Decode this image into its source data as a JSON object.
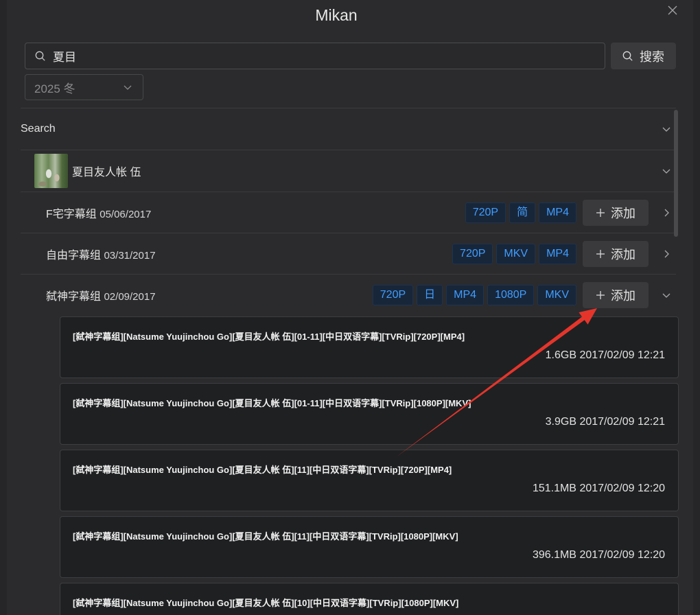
{
  "window": {
    "title": "Mikan"
  },
  "search": {
    "value": "夏目",
    "button_label": "搜索"
  },
  "season": {
    "selected": "2025 冬"
  },
  "results": {
    "section_label": "Search",
    "series": [
      {
        "title": "夏目友人帐 伍",
        "groups": [
          {
            "name": "F宅字幕组",
            "date": "05/06/2017",
            "tags": [
              "720P",
              "简",
              "MP4"
            ],
            "add_label": "添加",
            "chevron": "chevron-right-icon"
          },
          {
            "name": "自由字幕组",
            "date": "03/31/2017",
            "tags": [
              "720P",
              "MKV",
              "MP4"
            ],
            "add_label": "添加",
            "chevron": "chevron-right-icon"
          },
          {
            "name": "弑神字幕组",
            "date": "02/09/2017",
            "tags": [
              "720P",
              "日",
              "MP4",
              "1080P",
              "MKV"
            ],
            "add_label": "添加",
            "chevron": "chevron-down-icon",
            "files": [
              {
                "title": "[弑神字幕组][Natsume Yuujinchou Go][夏目友人帐 伍][01-11][中日双语字幕][TVRip][720P][MP4]",
                "size": "1.6GB",
                "datetime": "2017/02/09 12:21"
              },
              {
                "title": "[弑神字幕组][Natsume Yuujinchou Go][夏目友人帐 伍][01-11][中日双语字幕][TVRip][1080P][MKV]",
                "size": "3.9GB",
                "datetime": "2017/02/09 12:21"
              },
              {
                "title": "[弑神字幕组][Natsume Yuujinchou Go][夏目友人帐 伍][11][中日双语字幕][TVRip][720P][MP4]",
                "size": "151.1MB",
                "datetime": "2017/02/09 12:20"
              },
              {
                "title": "[弑神字幕组][Natsume Yuujinchou Go][夏目友人帐 伍][11][中日双语字幕][TVRip][1080P][MKV]",
                "size": "396.1MB",
                "datetime": "2017/02/09 12:20"
              },
              {
                "title": "[弑神字幕组][Natsume Yuujinchou Go][夏目友人帐 伍][10][中日双语字幕][TVRip][1080P][MKV]"
              }
            ]
          }
        ]
      }
    ]
  },
  "icons": {
    "close": "close-icon",
    "search": "search-icon",
    "season_dropdown": "chevron-down-icon",
    "add": "plus-icon",
    "section_toggle": "chevron-down-icon",
    "series_toggle": "chevron-down-icon"
  },
  "colors": {
    "tag_text": "#409eff",
    "tag_bg": "#18263a",
    "tag_border": "#1d3350",
    "annotation_arrow": "#e5352b"
  }
}
